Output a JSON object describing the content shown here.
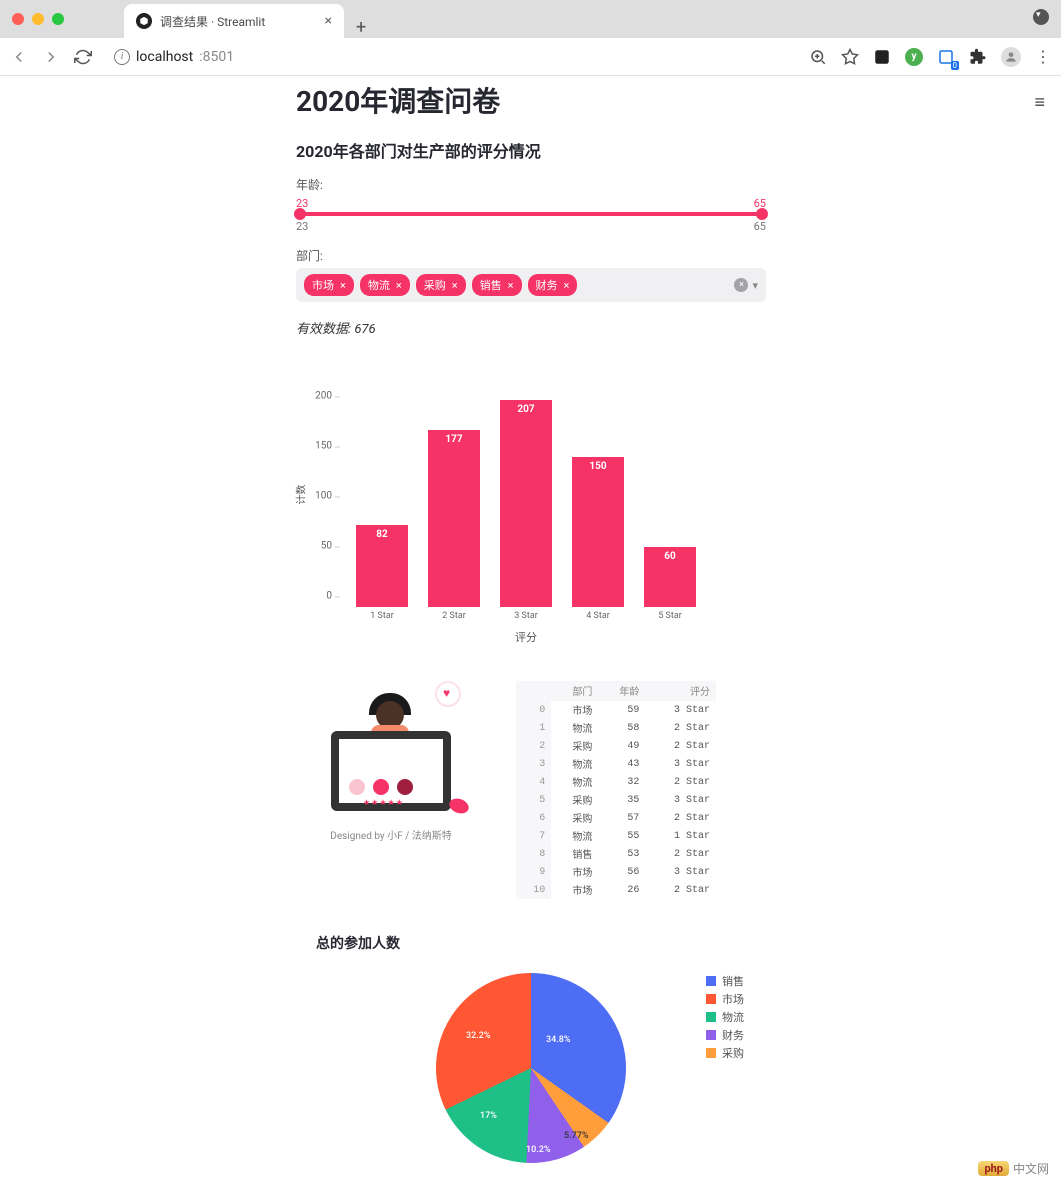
{
  "browser": {
    "tab_title": "调查结果 · Streamlit",
    "url_host": "localhost",
    "url_port": ":8501",
    "extension_badge": "0"
  },
  "page": {
    "title": "2020年调查问卷",
    "subheader": "2020年各部门对生产部的评分情况"
  },
  "slider": {
    "label": "年龄:",
    "low": "23",
    "high": "65",
    "min": "23",
    "max": "65"
  },
  "multiselect": {
    "label": "部门:",
    "tags": [
      "市场",
      "物流",
      "采购",
      "销售",
      "财务"
    ]
  },
  "valid_data": {
    "prefix": "有效数据: ",
    "value": "676"
  },
  "chart_data": {
    "type": "bar",
    "categories": [
      "1 Star",
      "2 Star",
      "3 Star",
      "4 Star",
      "5 Star"
    ],
    "values": [
      82,
      177,
      207,
      150,
      60
    ],
    "ylabel": "计数",
    "xlabel": "评分",
    "yticks": [
      0,
      50,
      100,
      150,
      200
    ],
    "ylim": [
      0,
      220
    ],
    "color": "#f63366"
  },
  "illustration_caption": "Designed by 小F / 法纳斯特",
  "table": {
    "columns": [
      "部门",
      "年龄",
      "评分"
    ],
    "rows": [
      {
        "idx": "0",
        "dept": "市场",
        "age": "59",
        "rating": "3 Star"
      },
      {
        "idx": "1",
        "dept": "物流",
        "age": "58",
        "rating": "2 Star"
      },
      {
        "idx": "2",
        "dept": "采购",
        "age": "49",
        "rating": "2 Star"
      },
      {
        "idx": "3",
        "dept": "物流",
        "age": "43",
        "rating": "3 Star"
      },
      {
        "idx": "4",
        "dept": "物流",
        "age": "32",
        "rating": "2 Star"
      },
      {
        "idx": "5",
        "dept": "采购",
        "age": "35",
        "rating": "3 Star"
      },
      {
        "idx": "6",
        "dept": "采购",
        "age": "57",
        "rating": "2 Star"
      },
      {
        "idx": "7",
        "dept": "物流",
        "age": "55",
        "rating": "1 Star"
      },
      {
        "idx": "8",
        "dept": "销售",
        "age": "53",
        "rating": "2 Star"
      },
      {
        "idx": "9",
        "dept": "市场",
        "age": "56",
        "rating": "3 Star"
      },
      {
        "idx": "10",
        "dept": "市场",
        "age": "26",
        "rating": "2 Star"
      }
    ]
  },
  "pie": {
    "title": "总的参加人数",
    "chart_data": {
      "type": "pie",
      "series": [
        {
          "name": "销售",
          "value": 34.8,
          "color": "#4e6df5"
        },
        {
          "name": "市场",
          "value": 32.2,
          "color": "#ff5733"
        },
        {
          "name": "物流",
          "value": 17.0,
          "color": "#1ec088"
        },
        {
          "name": "财务",
          "value": 10.2,
          "color": "#9060eb"
        },
        {
          "name": "采购",
          "value": 5.77,
          "color": "#ff9e3b"
        }
      ]
    },
    "labels": {
      "l1": "34.8%",
      "l2": "5.77%",
      "l3": "10.2%",
      "l4": "17%",
      "l5": "32.2%"
    },
    "legend": [
      "销售",
      "市场",
      "物流",
      "财务",
      "采购"
    ]
  },
  "watermark": {
    "badge": "php",
    "text": "中文网"
  }
}
